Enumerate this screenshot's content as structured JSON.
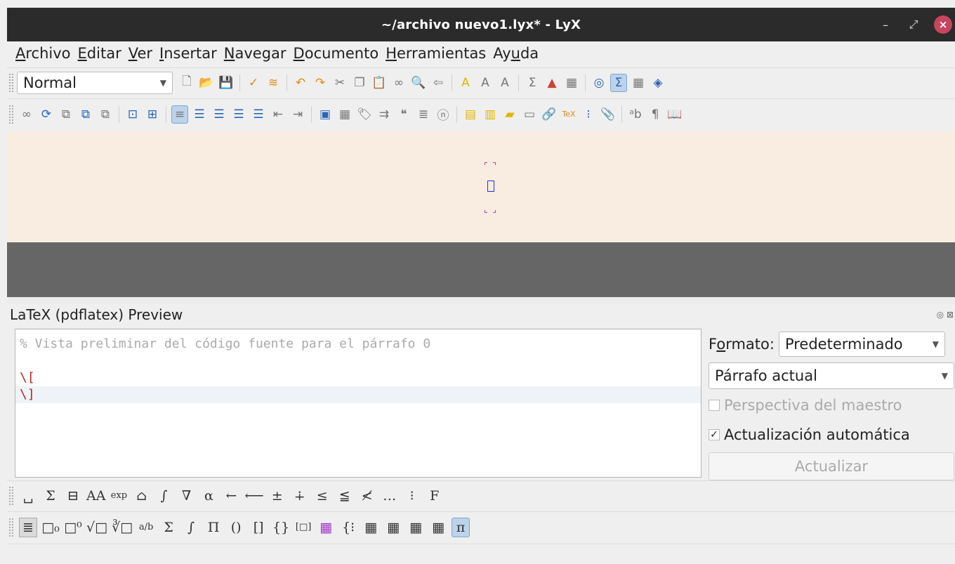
{
  "window": {
    "title": "~/archivo nuevo1.lyx* - LyX",
    "controls": {
      "minimize": "–",
      "maximize": "⤢",
      "close": "×"
    }
  },
  "menu": [
    {
      "mnemonic": "A",
      "rest": "rchivo"
    },
    {
      "mnemonic": "E",
      "rest": "ditar"
    },
    {
      "mnemonic": "V",
      "rest": "er"
    },
    {
      "mnemonic": "I",
      "rest": "nsertar"
    },
    {
      "mnemonic": "N",
      "rest": "avegar"
    },
    {
      "mnemonic": "D",
      "rest": "ocumento"
    },
    {
      "mnemonic": "H",
      "rest": "erramientas"
    },
    {
      "pre": "Ay",
      "mnemonic": "u",
      "rest": "da"
    }
  ],
  "toolbar": {
    "paragraph_style": "Normal",
    "icons_row1": [
      {
        "name": "new-document-icon",
        "glyph": "🗋"
      },
      {
        "name": "open-folder-icon",
        "glyph": "📂"
      },
      {
        "name": "save-icon",
        "glyph": "💾"
      },
      {
        "sep": true
      },
      {
        "name": "spellcheck-icon",
        "glyph": "✓"
      },
      {
        "name": "spellcheck-continuous-icon",
        "glyph": "≋"
      },
      {
        "sep": true
      },
      {
        "name": "undo-icon",
        "glyph": "↶"
      },
      {
        "name": "redo-icon",
        "glyph": "↷"
      },
      {
        "name": "cut-icon",
        "glyph": "✂"
      },
      {
        "name": "copy-icon",
        "glyph": "❐"
      },
      {
        "name": "paste-icon",
        "glyph": "📋"
      },
      {
        "name": "find-replace-icon",
        "glyph": "∞"
      },
      {
        "name": "search-icon",
        "glyph": "🔍"
      },
      {
        "name": "back-arrow-icon",
        "glyph": "⇦"
      },
      {
        "sep": true
      },
      {
        "name": "emphasis-icon",
        "glyph": "A"
      },
      {
        "name": "noun-icon",
        "glyph": "A"
      },
      {
        "name": "apply-style-icon",
        "glyph": "A"
      },
      {
        "sep": true
      },
      {
        "name": "math-sum-icon",
        "glyph": "Σ"
      },
      {
        "name": "insert-graphics-icon",
        "glyph": "▲"
      },
      {
        "name": "insert-table-icon",
        "glyph": "▦"
      },
      {
        "sep": true
      },
      {
        "name": "navigator-icon",
        "glyph": "◎"
      },
      {
        "name": "math-panel-icon",
        "glyph": "Σ",
        "active": true
      },
      {
        "name": "table-panel-icon",
        "glyph": "▦"
      },
      {
        "name": "source-view-icon",
        "glyph": "◈"
      }
    ],
    "icons_row2": [
      {
        "name": "view-pdf-icon",
        "glyph": "∞"
      },
      {
        "name": "update-icon",
        "glyph": "⟳"
      },
      {
        "name": "view-master-icon",
        "glyph": "⧉"
      },
      {
        "name": "update-master-icon",
        "glyph": "⧉"
      },
      {
        "name": "view-other-icon",
        "glyph": "⧉"
      },
      {
        "sep": true
      },
      {
        "name": "view-source-icon",
        "glyph": "⊡"
      },
      {
        "name": "preview-icon",
        "glyph": "⊞"
      },
      {
        "sep": true
      },
      {
        "name": "align-justify-icon",
        "glyph": "≡",
        "active": true
      },
      {
        "name": "list-bullet-icon",
        "glyph": "☰"
      },
      {
        "name": "list-bullet2-icon",
        "glyph": "☰"
      },
      {
        "name": "list-numbered-icon",
        "glyph": "☰"
      },
      {
        "name": "list-description-icon",
        "glyph": "☰"
      },
      {
        "name": "indent-decrease-icon",
        "glyph": "⇤"
      },
      {
        "name": "indent-increase-icon",
        "glyph": "⇥"
      },
      {
        "sep": true
      },
      {
        "name": "insert-figure-icon",
        "glyph": "▣"
      },
      {
        "name": "insert-table-float-icon",
        "glyph": "▦"
      },
      {
        "name": "insert-label-icon",
        "glyph": "🏷"
      },
      {
        "name": "insert-cross-ref-icon",
        "glyph": "⇉"
      },
      {
        "name": "insert-citation-icon",
        "glyph": "❝"
      },
      {
        "name": "insert-index-icon",
        "glyph": "≣"
      },
      {
        "name": "insert-nomenclature-icon",
        "glyph": "ⓝ"
      },
      {
        "sep": true
      },
      {
        "name": "insert-footnote-icon",
        "glyph": "▤"
      },
      {
        "name": "insert-marginnote-icon",
        "glyph": "▥"
      },
      {
        "name": "insert-note-icon",
        "glyph": "▰"
      },
      {
        "name": "insert-box-icon",
        "glyph": "▭"
      },
      {
        "name": "insert-hyperlink-icon",
        "glyph": "🔗"
      },
      {
        "name": "insert-tex-icon",
        "glyph": "TeX"
      },
      {
        "name": "insert-list-of-icon",
        "glyph": "⁝"
      },
      {
        "name": "insert-attachment-icon",
        "glyph": "📎"
      },
      {
        "sep": true
      },
      {
        "name": "insert-abbreviation-icon",
        "glyph": "ᵃb"
      },
      {
        "name": "paragraph-mark-icon",
        "glyph": "¶"
      },
      {
        "name": "book-icon",
        "glyph": "📖"
      }
    ]
  },
  "preview": {
    "title": "LaTeX (pdflatex) Preview",
    "panel_controls": "◎ ⊠",
    "code_lines": [
      {
        "text": "% Vista preliminar del código fuente para el párrafo 0",
        "kind": "comment"
      },
      {
        "text": "",
        "kind": "blank"
      },
      {
        "text": "\\[",
        "kind": "math"
      },
      {
        "text": "\\]",
        "kind": "math",
        "highlight": true
      }
    ],
    "format_label_mnemonic": "o",
    "format_label_pre": "F",
    "format_label_post": "rmato:",
    "format_value": "Predeterminado",
    "scope_value": "Párrafo actual",
    "master_view_label": "Perspectiva del maestro",
    "master_view_checked": false,
    "auto_update_label": "Actualización automática",
    "auto_update_checked": true,
    "update_button": "Actualizar"
  },
  "math_toolbar1": [
    "␣",
    "Σ",
    "⊟",
    "AA",
    "exp",
    "⌂",
    "∫",
    "∇",
    "α",
    "←",
    "⟵",
    "±",
    "∔",
    "≤",
    "≦",
    "≮",
    "…",
    "⁝",
    "F"
  ],
  "math_toolbar2": [
    "≣",
    "□₀",
    "□⁰",
    "√□",
    "∛□",
    "a/b",
    "Σ",
    "∫",
    "Π",
    "()",
    "[]",
    "{}",
    "[□]",
    "▦",
    "{⁝",
    "▦",
    "▦",
    "▦",
    "▦",
    "π"
  ]
}
